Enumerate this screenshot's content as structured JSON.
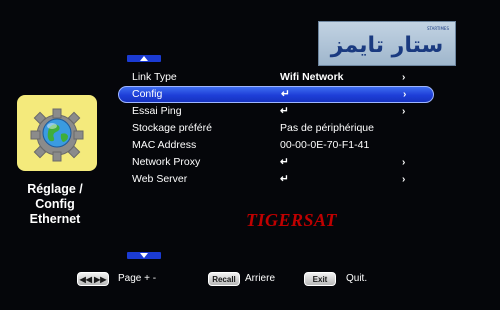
{
  "header": {
    "logo_text": "ستار تايمز",
    "logo_small": "STARTIMES"
  },
  "menu": {
    "items": [
      {
        "label": "Link Type",
        "value": "Wifi Network",
        "value_style": "bold",
        "arrow": "›"
      },
      {
        "label": "Config",
        "value": "↵",
        "value_style": "bold",
        "arrow": "›",
        "selected": true
      },
      {
        "label": "Essai Ping",
        "value": "↵",
        "value_style": "bold",
        "arrow": "›"
      },
      {
        "label": "Stockage préféré",
        "value": "Pas de périphérique",
        "value_style": "plain",
        "arrow": ""
      },
      {
        "label": "MAC Address",
        "value": "00-00-0E-70-F1-41",
        "value_style": "plain",
        "arrow": ""
      },
      {
        "label": "Network Proxy",
        "value": "↵",
        "value_style": "bold",
        "arrow": "›"
      },
      {
        "label": "Web Server",
        "value": "↵",
        "value_style": "bold",
        "arrow": "›"
      }
    ]
  },
  "sidebar": {
    "title_line1": "Réglage /",
    "title_line2": "Config",
    "title_line3": "Ethernet",
    "icon": "globe-gear-icon"
  },
  "watermark": "TIGERSAT",
  "footer": {
    "page_key": "◀◀ ▶▶",
    "page_label": "Page + -",
    "recall_key": "Recall",
    "recall_label": "Arriere",
    "exit_key": "Exit",
    "exit_label": "Quit."
  },
  "colors": {
    "accent": "#1b3bd3",
    "selected_row": "#2a4fe6",
    "icon_bg": "#f4ea7c",
    "watermark": "#c00000"
  }
}
